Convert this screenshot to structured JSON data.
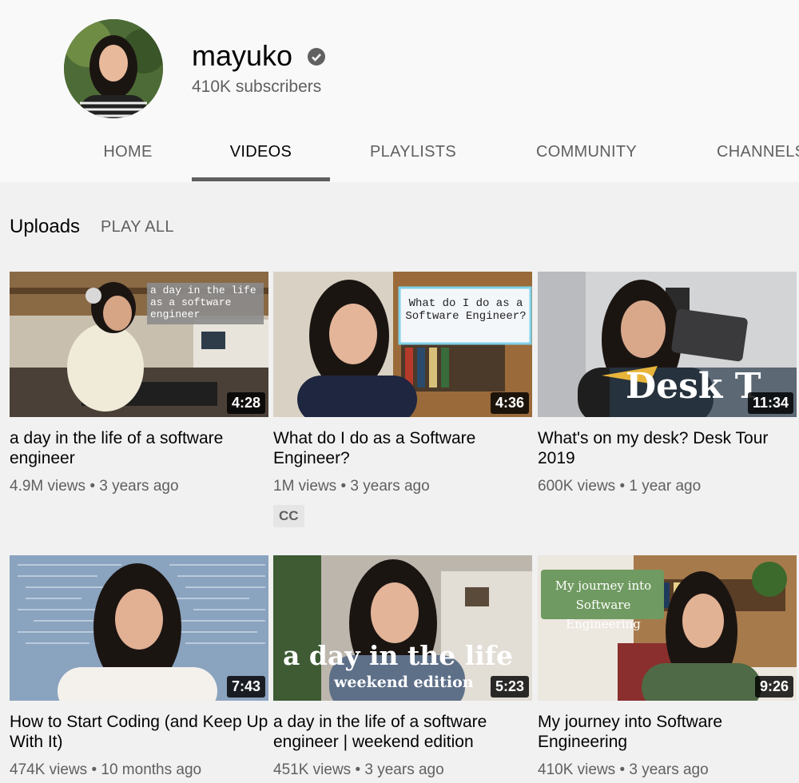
{
  "channel": {
    "name": "mayuko",
    "subscribers": "410K subscribers"
  },
  "tabs": [
    {
      "label": "HOME"
    },
    {
      "label": "VIDEOS"
    },
    {
      "label": "PLAYLISTS"
    },
    {
      "label": "COMMUNITY"
    },
    {
      "label": "CHANNELS"
    }
  ],
  "section": {
    "title": "Uploads",
    "play_all": "PLAY ALL"
  },
  "videos": [
    {
      "title": "a day in the life of a software engineer",
      "duration": "4:28",
      "views": "4.9M views",
      "age": "3 years ago",
      "overlay": "a day in the life as a software engineer"
    },
    {
      "title": "What do I do as a Software Engineer?",
      "duration": "4:36",
      "views": "1M views",
      "age": "3 years ago",
      "badge": "CC",
      "overlay": "What do I do as a Software Engineer?"
    },
    {
      "title": "What's on my desk? Desk Tour 2019",
      "duration": "11:34",
      "views": "600K views",
      "age": "1 year ago",
      "overlay": "Desk T"
    },
    {
      "title": "How to Start Coding (and Keep Up With It)",
      "duration": "7:43",
      "views": "474K views",
      "age": "10 months ago"
    },
    {
      "title": "a day in the life of a software engineer | weekend edition",
      "duration": "5:23",
      "views": "451K views",
      "age": "3 years ago",
      "overlay": "a day in the life",
      "overlay2": "weekend edition"
    },
    {
      "title": "My journey into Software Engineering",
      "duration": "9:26",
      "views": "410K views",
      "age": "3 years ago",
      "overlay": "My journey into Software Engineering"
    }
  ],
  "separator": "•"
}
